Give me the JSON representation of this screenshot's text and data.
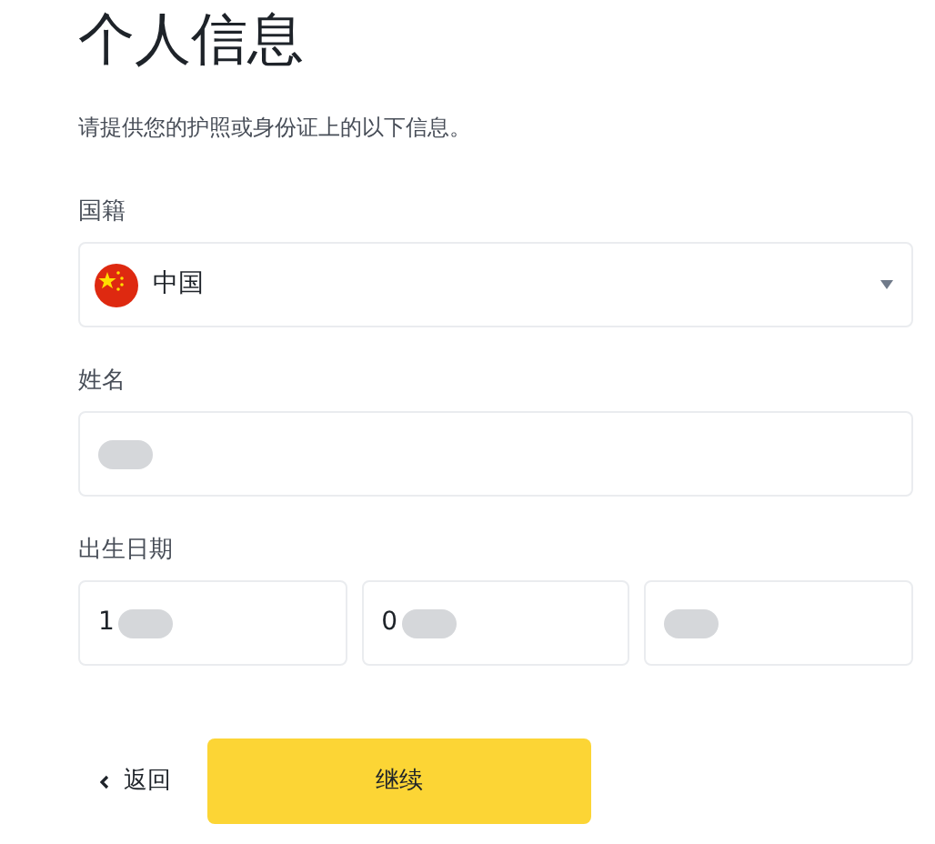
{
  "title": "个人信息",
  "subtitle": "请提供您的护照或身份证上的以下信息。",
  "nationality": {
    "label": "国籍",
    "value": "中国"
  },
  "name": {
    "label": "姓名",
    "redacted": true
  },
  "birth_date": {
    "label": "出生日期",
    "fields": [
      {
        "value": "1",
        "redacted": true
      },
      {
        "value": "0",
        "redacted": true
      },
      {
        "redacted": true
      }
    ]
  },
  "back": {
    "label": "返回"
  },
  "continue_button": "继续"
}
